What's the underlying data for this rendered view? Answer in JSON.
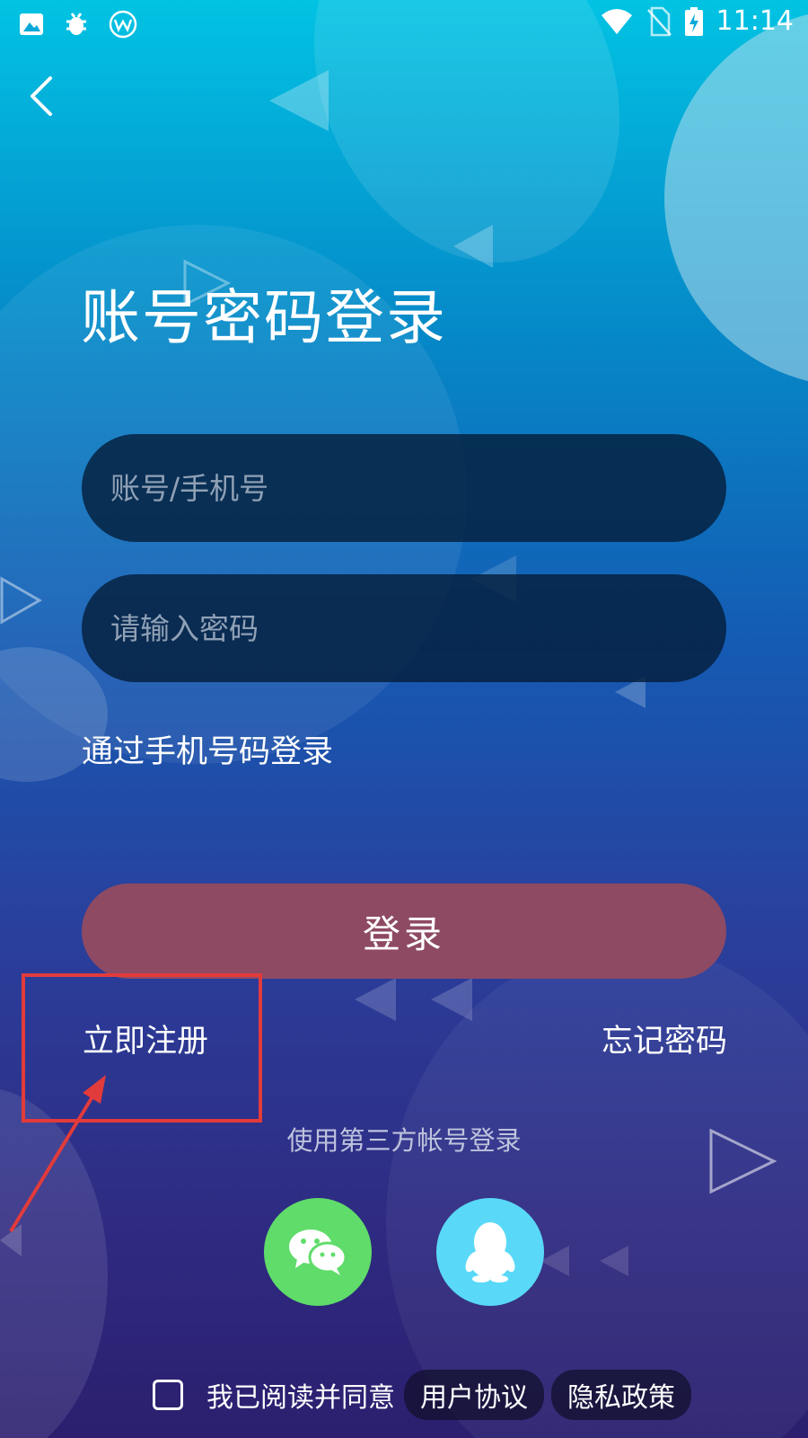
{
  "status_bar": {
    "time": "11:14",
    "left_icons": [
      "image-icon",
      "bug-icon",
      "app-logo-icon"
    ],
    "right_icons": [
      "wifi-icon",
      "no-sim-icon",
      "battery-charging-icon"
    ]
  },
  "header": {
    "back_icon": "chevron-left-icon"
  },
  "page": {
    "title": "账号密码登录"
  },
  "form": {
    "account_placeholder": "账号/手机号",
    "account_value": "",
    "password_placeholder": "请输入密码",
    "password_value": "",
    "phone_login_link": "通过手机号码登录",
    "login_button": "登录",
    "register_link": "立即注册",
    "forgot_link": "忘记密码"
  },
  "third_party": {
    "label": "使用第三方帐号登录",
    "providers": [
      {
        "icon": "wechat-icon",
        "color": "#5fdc6a"
      },
      {
        "icon": "qq-icon",
        "color": "#59d9f7"
      }
    ]
  },
  "agreement": {
    "checked": false,
    "text": "我已阅读并同意",
    "user_agreement": "用户协议",
    "privacy_policy": "隐私政策"
  },
  "colors": {
    "accent_login": "#8e4a63",
    "annotation": "#e23b3b"
  }
}
